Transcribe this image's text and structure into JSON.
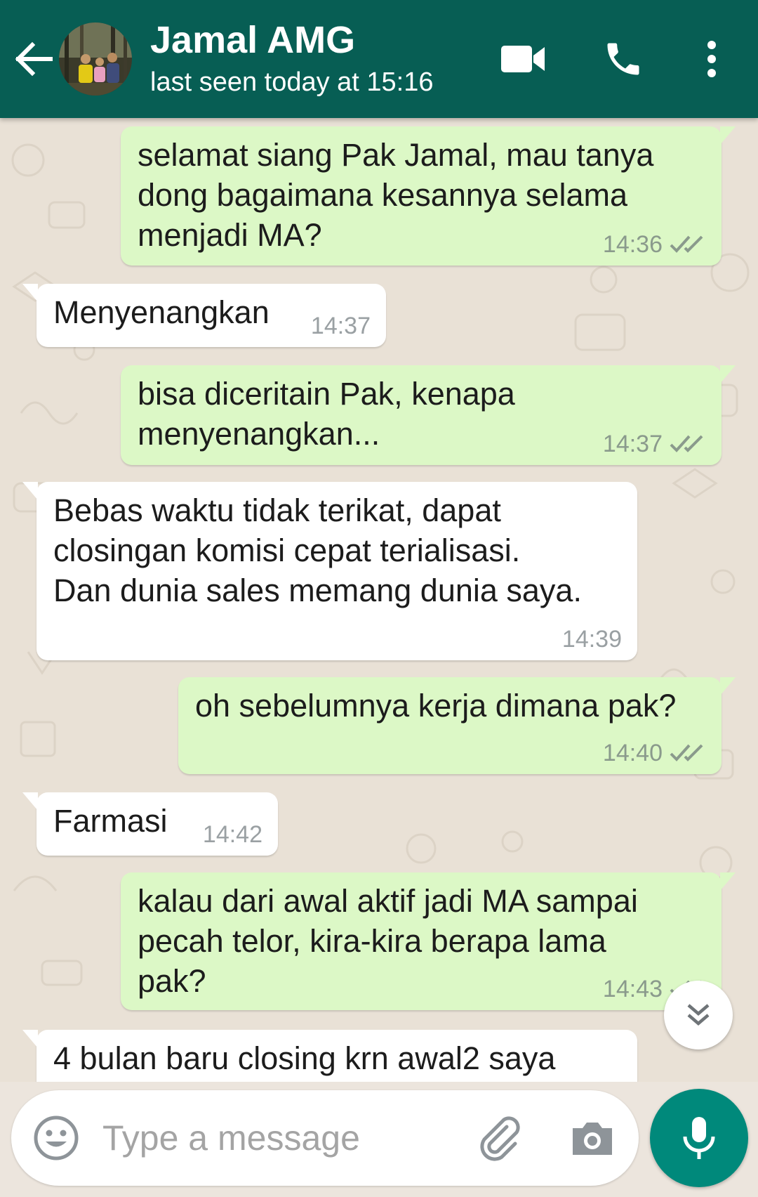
{
  "header": {
    "contact_name": "Jamal AMG",
    "last_seen": "last seen today at 15:16",
    "icons": [
      "back-arrow-icon",
      "avatar",
      "video-call-icon",
      "phone-icon",
      "more-options-icon"
    ]
  },
  "messages": [
    {
      "direction": "out",
      "text": "selamat siang Pak Jamal, mau tanya\ndong bagaimana kesannya selama\nmenjadi MA?",
      "time": "14:36",
      "status": "read"
    },
    {
      "direction": "in",
      "text": "Menyenangkan",
      "time": "14:37"
    },
    {
      "direction": "out",
      "text": "bisa diceritain Pak, kenapa\nmenyenangkan...",
      "time": "14:37",
      "status": "read"
    },
    {
      "direction": "in",
      "text": "Bebas waktu tidak terikat, dapat\nclosingan komisi cepat terialisasi.\nDan dunia sales memang dunia saya.",
      "time": "14:39"
    },
    {
      "direction": "out",
      "text": "oh sebelumnya kerja dimana pak?",
      "time": "14:40",
      "status": "read"
    },
    {
      "direction": "in",
      "text": "Farmasi",
      "time": "14:42"
    },
    {
      "direction": "out",
      "text": "kalau dari awal aktif jadi MA sampai\npecah telor, kira-kira berapa lama\npak?",
      "time": "14:43",
      "status": "read"
    },
    {
      "direction": "in",
      "text": "4 bulan baru closing krn awal2 saya",
      "time": ""
    }
  ],
  "composer": {
    "placeholder": "Type a message"
  },
  "colors": {
    "header": "#075e54",
    "outgoing_bubble": "#dcf8c6",
    "incoming_bubble": "#ffffff",
    "read_ticks": "#8a9a8c",
    "mic_button": "#00897b",
    "wallpaper": "#e9e1d6"
  }
}
